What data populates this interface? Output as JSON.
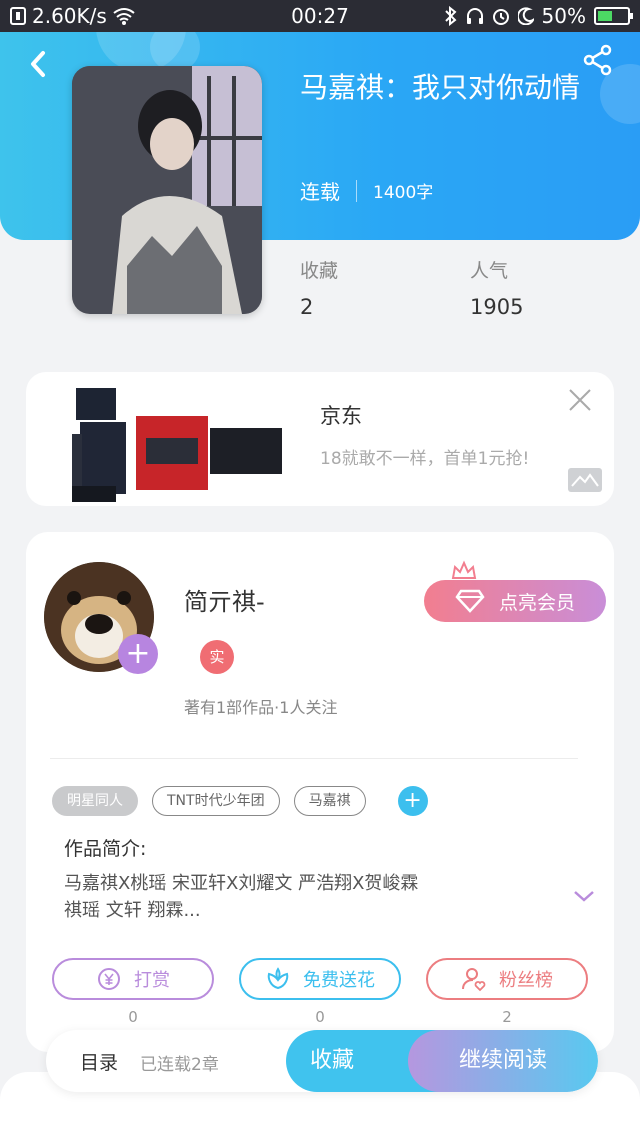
{
  "status_bar": {
    "net_speed": "2.60K/s",
    "time": "00:27",
    "battery": "50%",
    "battery_level": 0.5
  },
  "book": {
    "title": "马嘉祺：我只对你动情",
    "status": "连载",
    "word_count": "1400字",
    "favorites_label": "收藏",
    "favorites_value": "2",
    "popularity_label": "人气",
    "popularity_value": "1905"
  },
  "ad": {
    "brand": "京东",
    "slogan": "18就敢不一样，首单1元抢!"
  },
  "author": {
    "name": "简亓祺-",
    "verified_badge": "实",
    "desc": "著有1部作品·1人关注",
    "vip_button": "点亮会员",
    "plus": "+"
  },
  "tags": [
    "明星同人",
    "TNT时代少年团",
    "马嘉祺"
  ],
  "tag_add": "+",
  "intro": {
    "label": "作品简介:",
    "line1": "马嘉祺X桃瑶  宋亚轩X刘耀文  严浩翔X贺峻霖",
    "line2": "祺瑶  文轩  翔霖..."
  },
  "actions": [
    {
      "label": "打赏",
      "count": "0",
      "color": "#b98cdc"
    },
    {
      "label": "免费送花",
      "count": "0",
      "color": "#3cbfee"
    },
    {
      "label": "粉丝榜",
      "count": "2",
      "color": "#ec7d80"
    }
  ],
  "bottom": {
    "toc": "目录",
    "toc_status": "已连载2章",
    "collect": "收藏",
    "continue_reading": "继续阅读"
  }
}
